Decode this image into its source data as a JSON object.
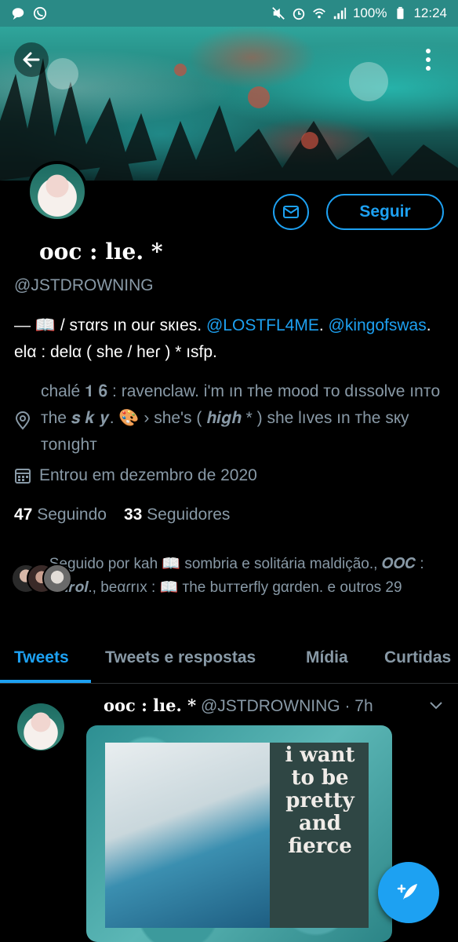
{
  "status_bar": {
    "battery": "100%",
    "time": "12:24"
  },
  "profile": {
    "name": "ooc : lıe. *",
    "handle": "@JSTDROWNING",
    "follow_label": "Seguir",
    "bio_part1": "— 📖 / sтαrs ın ouɾ sкıes. ",
    "bio_mention1": "@LOSTFL4ME",
    "bio_part2": ". ",
    "bio_mention2": "@kingofswas",
    "bio_part3": ". elα : delα ( she / heɾ ) * ısfp.",
    "location": "chalé 𝟏 𝟔 : ravenclaw. i'm ın тhe mood тo dıssolve ınтo тhe 𝒔 𝒌 𝒚. 🎨 › she's ( 𝒉𝒊𝒈𝒉 * ) she lıves ın тhe sкy тonıghт",
    "joined": "Entrou em dezembro de 2020",
    "following_count": "47",
    "following_label": "Seguindo",
    "followers_count": "33",
    "followers_label": "Seguidores",
    "followed_by": "Seguido por kah 📖 sombria e solitária maldição., 𝑶𝑶𝑪 : 𝑪𝒂𝒓𝒐𝒍., beαɾrıx : 📖 тhe buттerfly gαrden. e outros 29"
  },
  "tabs": [
    "Tweets",
    "Tweets e respostas",
    "Mídia",
    "Curtidas"
  ],
  "tweet": {
    "name": "ooc : lıe. *",
    "handle": "@JSTDROWNING",
    "time": "· 7h",
    "image_text": "i want to be pretty and fierce"
  },
  "colors": {
    "accent": "#1da1f2",
    "muted": "#8899a6",
    "background": "#000000"
  },
  "icons": [
    "back-arrow-icon",
    "more-vertical-icon",
    "mail-icon",
    "location-pin-icon",
    "calendar-icon",
    "chevron-down-icon",
    "compose-tweet-icon"
  ]
}
